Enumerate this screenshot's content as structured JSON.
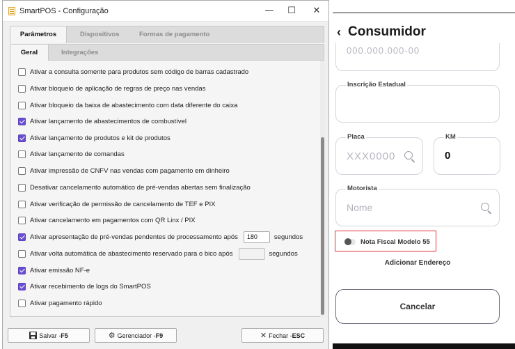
{
  "window": {
    "title": "SmartPOS - Configuração",
    "minimize": "—",
    "maximize": "☐",
    "close": "✕"
  },
  "tabs_main": [
    "Parâmetros",
    "Dispositivos",
    "Formas de pagamento"
  ],
  "tabs_sub": [
    "Geral",
    "Integrações"
  ],
  "options": [
    {
      "label": "Ativar a consulta somente para produtos sem código de barras cadastrado",
      "checked": false
    },
    {
      "label": "Ativar bloqueio de aplicação de regras de preço nas vendas",
      "checked": false
    },
    {
      "label": "Ativar bloqueio da baixa de abastecimento com data diferente do caixa",
      "checked": false
    },
    {
      "label": "Ativar lançamento de abastecimentos de combustível",
      "checked": true
    },
    {
      "label": "Ativar lançamento de produtos e kit de produtos",
      "checked": true
    },
    {
      "label": "Ativar lançamento de comandas",
      "checked": false
    },
    {
      "label": "Ativar impressão de CNFV nas vendas com pagamento em dinheiro",
      "checked": false
    },
    {
      "label": "Desativar cancelamento automático de pré-vendas abertas sem finalização",
      "checked": false
    },
    {
      "label": "Ativar verificação de permissão de cancelamento de TEF e PIX",
      "checked": false
    },
    {
      "label": "Ativar cancelamento em pagamentos com QR Linx / PIX",
      "checked": false
    },
    {
      "label": "Ativar apresentação de pré-vendas pendentes de processamento após",
      "checked": true,
      "value": "180",
      "suffix": "segundos"
    },
    {
      "label": "Ativar volta automática de abastecimento reservado para o bico após",
      "checked": false,
      "value": "",
      "suffix": "segundos"
    },
    {
      "label": "Ativar emissão NF-e",
      "checked": true
    },
    {
      "label": "Ativar recebimento de logs do SmartPOS",
      "checked": true
    },
    {
      "label": "Ativar pagamento rápido",
      "checked": false
    }
  ],
  "footer": {
    "save": {
      "label": "Salvar - ",
      "key": "F5"
    },
    "manager": {
      "label": "Gerenciador - ",
      "key": "F9"
    },
    "close": {
      "label": "Fechar - ",
      "key": "ESC"
    }
  },
  "phone": {
    "back_icon": "‹",
    "title": "Consumidor",
    "partial_value": "000.000.000-00",
    "ie_label": "Inscrição Estadual",
    "placa_label": "Placa",
    "placa_placeholder": "XXX0000",
    "km_label": "KM",
    "km_value": "0",
    "motorista_label": "Motorista",
    "motorista_placeholder": "Nome",
    "nf_label": "Nota Fiscal Modelo 55",
    "add_address": "Adicionar Endereço",
    "cancel": "Cancelar"
  },
  "colors": {
    "accent_checkbox": "#6a4fcf",
    "highlight_box": "#e03131"
  }
}
